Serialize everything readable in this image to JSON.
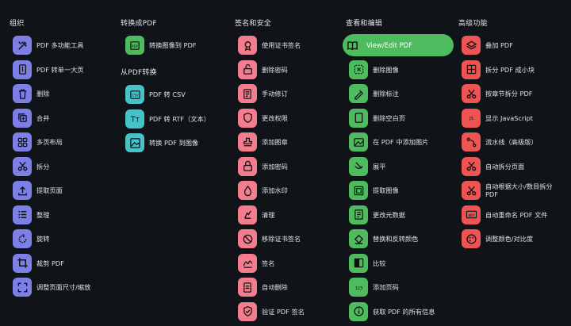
{
  "columns": [
    {
      "heading": "组织",
      "color": "#7b7fe6",
      "items": [
        {
          "label": "PDF 多功能工具",
          "icon": "tools-icon"
        },
        {
          "label": "PDF 转单一大页",
          "icon": "single-page-icon"
        },
        {
          "label": "删除",
          "icon": "trash-icon"
        },
        {
          "label": "合并",
          "icon": "merge-icon"
        },
        {
          "label": "多页布局",
          "icon": "grid-icon"
        },
        {
          "label": "拆分",
          "icon": "scissors-icon"
        },
        {
          "label": "提取页面",
          "icon": "upload-icon"
        },
        {
          "label": "整理",
          "icon": "list-icon"
        },
        {
          "label": "旋转",
          "icon": "rotate-icon"
        },
        {
          "label": "裁剪 PDF",
          "icon": "crop-icon"
        },
        {
          "label": "调整页面尺寸/缩放",
          "icon": "resize-icon"
        }
      ]
    },
    {
      "heading": "转换成PDF",
      "color": "#4dbb5e",
      "items": [
        {
          "label": "转换图像到 PDF",
          "icon": "image-to-pdf-icon"
        }
      ],
      "heading2": "从PDF转换",
      "items2": [
        {
          "label": "PDF 转 CSV",
          "icon": "csv-icon"
        },
        {
          "label": "PDF 转 RTF（文本）",
          "icon": "text-icon"
        },
        {
          "label": "转换 PDF 到图像",
          "icon": "pdf-to-image-icon"
        }
      ]
    },
    {
      "heading": "签名和安全",
      "color": "#f27d8f",
      "items": [
        {
          "label": "使用证书签名",
          "icon": "certificate-icon"
        },
        {
          "label": "删除密码",
          "icon": "unlock-icon"
        },
        {
          "label": "手动修订",
          "icon": "redact-icon"
        },
        {
          "label": "更改权限",
          "icon": "shield-icon"
        },
        {
          "label": "添加图章",
          "icon": "stamp-icon"
        },
        {
          "label": "添加密码",
          "icon": "lock-icon"
        },
        {
          "label": "添加水印",
          "icon": "droplet-icon"
        },
        {
          "label": "清理",
          "icon": "sanitize-icon"
        },
        {
          "label": "移除证书签名",
          "icon": "remove-cert-icon"
        },
        {
          "label": "签名",
          "icon": "signature-icon"
        },
        {
          "label": "自动删除",
          "icon": "auto-redact-icon"
        },
        {
          "label": "验证 PDF 签名",
          "icon": "verify-icon"
        }
      ]
    },
    {
      "heading": "查看和编辑",
      "color": "#4dbb5e",
      "active": {
        "label": "View/Edit PDF",
        "icon": "book-icon"
      },
      "items": [
        {
          "label": "删除图像",
          "icon": "remove-image-icon"
        },
        {
          "label": "删除标注",
          "icon": "remove-annotation-icon"
        },
        {
          "label": "删除空白页",
          "icon": "blank-page-icon"
        },
        {
          "label": "在 PDF 中添加图片",
          "icon": "add-image-icon"
        },
        {
          "label": "展平",
          "icon": "flatten-icon"
        },
        {
          "label": "提取图像",
          "icon": "extract-image-icon"
        },
        {
          "label": "更改元数据",
          "icon": "metadata-icon"
        },
        {
          "label": "替换和反转颜色",
          "icon": "paint-icon"
        },
        {
          "label": "比较",
          "icon": "compare-icon"
        },
        {
          "label": "添加页码",
          "icon": "page-numbers-icon"
        },
        {
          "label": "获取 PDF 的所有信息",
          "icon": "info-icon"
        }
      ]
    },
    {
      "heading": "高级功能",
      "color": "#ef5454",
      "items": [
        {
          "label": "叠加 PDF",
          "icon": "layers-icon"
        },
        {
          "label": "拆分 PDF 成小块",
          "icon": "split-chunks-icon"
        },
        {
          "label": "按章节拆分 PDF",
          "icon": "split-chapter-icon"
        },
        {
          "label": "显示 JavaScript",
          "icon": "js-icon"
        },
        {
          "label": "流水线（高级版）",
          "icon": "pipeline-icon"
        },
        {
          "label": "自动拆分页面",
          "icon": "auto-split-icon"
        },
        {
          "label": "自动根据大小/数目拆分 PDF",
          "icon": "split-size-icon"
        },
        {
          "label": "自动重命名 PDF 文件",
          "icon": "rename-icon"
        },
        {
          "label": "调整颜色/对比度",
          "icon": "contrast-icon"
        }
      ]
    }
  ]
}
